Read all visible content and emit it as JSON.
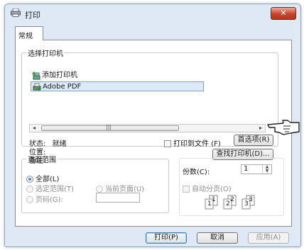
{
  "window": {
    "title": "打印",
    "close_label": "✕"
  },
  "tabs": [
    {
      "label": "常规"
    }
  ],
  "select_printer": {
    "legend": "选择打印机",
    "items": [
      {
        "label": "添加打印机",
        "icon": "add-printer-icon"
      },
      {
        "label": "Adobe PDF",
        "icon": "printer-icon",
        "selected": true
      }
    ],
    "scroll_grip": "|||",
    "scroll_left": "◂",
    "scroll_right": "▸"
  },
  "status": {
    "status_label": "状态:",
    "status_value": "就绪",
    "location_label": "位置:",
    "comment_label": "备注:"
  },
  "print_to_file": {
    "label": "打印到文件 (F)",
    "checked": false
  },
  "preferences_label": "首选项(R)",
  "find_printer_label": "查找打印机(D)...",
  "page_range": {
    "legend": "页面范围",
    "all_label": "全部(L)",
    "selection_label": "选定范围(T)",
    "current_page_label": "当前页面(U)",
    "pages_label": "页码(G):",
    "pages_value": ""
  },
  "copies": {
    "label": "份数(C):",
    "value": "1",
    "collate_label": "自动分页(O)",
    "collate_glyphs": [
      "1",
      "1",
      "2",
      "2",
      "3",
      "3"
    ]
  },
  "footer": {
    "print_label": "打印(P)",
    "cancel_label": "取消",
    "apply_label": "应用(A)"
  },
  "colors": {
    "accent": "#3a8ee6",
    "title_bg": "#dfe9f5",
    "close": "#c8452b"
  }
}
